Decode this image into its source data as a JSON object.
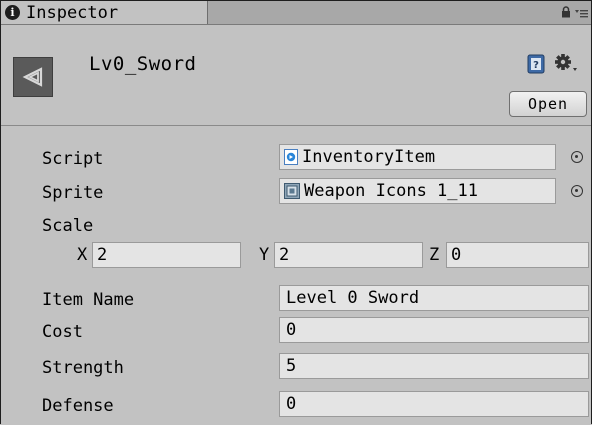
{
  "tab": {
    "title": "Inspector",
    "icon": "info-icon"
  },
  "header": {
    "object_name": "Lv0_Sword",
    "open_label": "Open"
  },
  "script": {
    "label": "Script",
    "value": "InventoryItem"
  },
  "sprite": {
    "label": "Sprite",
    "value": "Weapon Icons 1_11"
  },
  "scale": {
    "label": "Scale",
    "x_label": "X",
    "x_value": "2",
    "y_label": "Y",
    "y_value": "2",
    "z_label": "Z",
    "z_value": "0"
  },
  "item_name": {
    "label": "Item Name",
    "value": "Level 0 Sword"
  },
  "cost": {
    "label": "Cost",
    "value": "0"
  },
  "strength": {
    "label": "Strength",
    "value": "5"
  },
  "defense": {
    "label": "Defense",
    "value": "0"
  },
  "colors": {
    "panel": "#c2c2c2",
    "field": "#e4e4e4",
    "tabbar": "#a8a8a8",
    "accent": "#2a86d9"
  }
}
